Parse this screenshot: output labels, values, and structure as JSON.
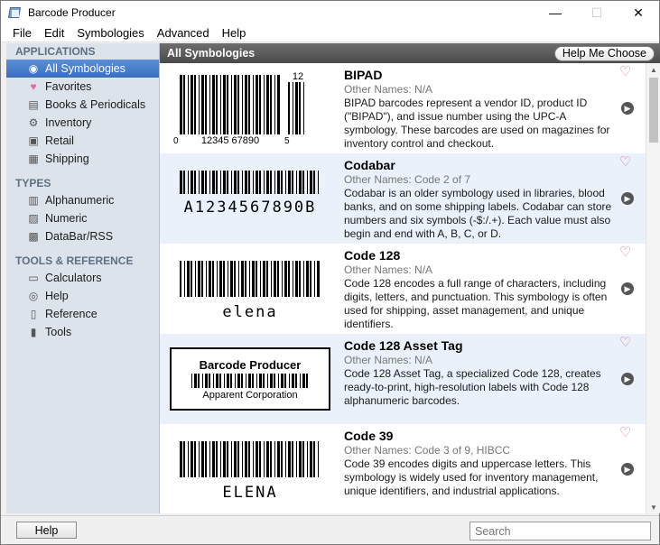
{
  "window": {
    "title": "Barcode Producer",
    "controls": [
      "—",
      "☐",
      "✕"
    ]
  },
  "menu": [
    "File",
    "Edit",
    "Symbologies",
    "Advanced",
    "Help"
  ],
  "sidebar": {
    "sections": [
      {
        "title": "APPLICATIONS",
        "items": [
          {
            "label": "All Symbologies",
            "icon": "◉",
            "selected": true
          },
          {
            "label": "Favorites",
            "icon": "♥"
          },
          {
            "label": "Books & Periodicals",
            "icon": "▤"
          },
          {
            "label": "Inventory",
            "icon": "⚙"
          },
          {
            "label": "Retail",
            "icon": "▣"
          },
          {
            "label": "Shipping",
            "icon": "▦"
          }
        ]
      },
      {
        "title": "TYPES",
        "items": [
          {
            "label": "Alphanumeric",
            "icon": "▥"
          },
          {
            "label": "Numeric",
            "icon": "▨"
          },
          {
            "label": "DataBar/RSS",
            "icon": "▩"
          }
        ]
      },
      {
        "title": "TOOLS & REFERENCE",
        "items": [
          {
            "label": "Calculators",
            "icon": "▭"
          },
          {
            "label": "Help",
            "icon": "◎"
          },
          {
            "label": "Reference",
            "icon": "▯"
          },
          {
            "label": "Tools",
            "icon": "▮"
          }
        ]
      }
    ]
  },
  "content": {
    "header_title": "All Symbologies",
    "help_me_choose": "Help Me Choose"
  },
  "symbologies": [
    {
      "name": "BIPAD",
      "other": "Other Names: N/A",
      "description": "BIPAD barcodes represent a vendor ID, product ID (\"BIPAD\"), and issue number using the UPC-A symbology. These barcodes are used on magazines for inventory control and checkout.",
      "barcode": {
        "kind": "upc",
        "left": "0",
        "mid": "12345 67890",
        "right": "5",
        "addon": "12"
      }
    },
    {
      "name": "Codabar",
      "other": "Other Names: Code 2 of 7",
      "description": "Codabar is an older symbology used in libraries, blood banks, and on some shipping labels. Codabar can store numbers and six symbols (-$:/.+). Each value must also begin and end with A, B, C, or D.",
      "barcode": {
        "kind": "linear",
        "caption": "A1234567890B"
      }
    },
    {
      "name": "Code 128",
      "other": "Other Names: N/A",
      "description": "Code 128 encodes a full range of characters, including digits, letters, and punctuation. This symbology is often used for shipping, asset management, and unique identifiers.",
      "barcode": {
        "kind": "linear",
        "caption": "elena"
      }
    },
    {
      "name": "Code 128 Asset Tag",
      "other": "Other Names: N/A",
      "description": "Code 128 Asset Tag, a specialized Code 128, creates ready-to-print, high-resolution labels with Code 128 alphanumeric barcodes.",
      "barcode": {
        "kind": "tag",
        "title": "Barcode Producer",
        "sub": "Apparent Corporation"
      }
    },
    {
      "name": "Code 39",
      "other": "Other Names: Code 3 of 9, HIBCC",
      "description": "Code 39 encodes digits and uppercase letters. This symbology is widely used for inventory management, unique identifiers, and industrial applications.",
      "barcode": {
        "kind": "linear",
        "caption": "ELENA"
      }
    }
  ],
  "footer": {
    "help_button": "Help",
    "search_placeholder": "Search"
  },
  "colors": {
    "selected": "#4a7fcc",
    "heart": "#e56aa0",
    "header": "#5a5a5a",
    "alt_row": "#eaf1fb"
  }
}
